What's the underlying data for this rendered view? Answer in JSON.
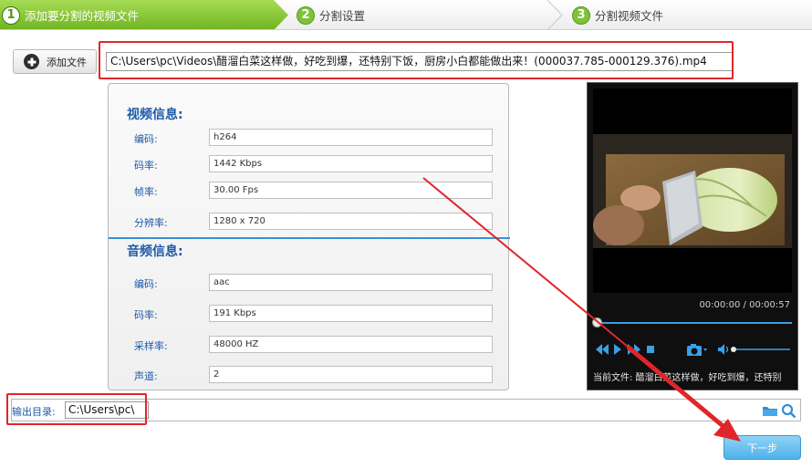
{
  "steps": [
    {
      "num": "1",
      "label": "添加要分割的视频文件"
    },
    {
      "num": "2",
      "label": "分割设置"
    },
    {
      "num": "3",
      "label": "分割视频文件"
    }
  ],
  "add_file": {
    "label": "添加文件",
    "icon": "plus-icon"
  },
  "file_path": "C:\\Users\\pc\\Videos\\醋溜白菜这样做，好吃到爆，还特别下饭，厨房小白都能做出来！(000037.785-000129.376).mp4",
  "video_info": {
    "title": "视频信息:",
    "fields": [
      {
        "label": "编码:",
        "value": "h264"
      },
      {
        "label": "码率:",
        "value": "1442 Kbps"
      },
      {
        "label": "帧率:",
        "value": "30.00 Fps"
      },
      {
        "label": "分辨率:",
        "value": "1280 x 720"
      }
    ]
  },
  "audio_info": {
    "title": "音频信息:",
    "fields": [
      {
        "label": "编码:",
        "value": "aac"
      },
      {
        "label": "码率:",
        "value": "191 Kbps"
      },
      {
        "label": "采样率:",
        "value": "48000 HZ"
      },
      {
        "label": "声道:",
        "value": "2"
      }
    ]
  },
  "player": {
    "time": "00:00:00 / 00:00:57",
    "current_file": "当前文件: 醋溜白菜这样做，好吃到爆，还特别",
    "progress": 0
  },
  "output": {
    "label": "输出目录:",
    "value": "C:\\Users\\pc\\"
  },
  "next_button": "下一步",
  "colors": {
    "accent_green": "#7cc23a",
    "accent_blue": "#3c8fd8",
    "highlight_red": "#e0262a"
  }
}
